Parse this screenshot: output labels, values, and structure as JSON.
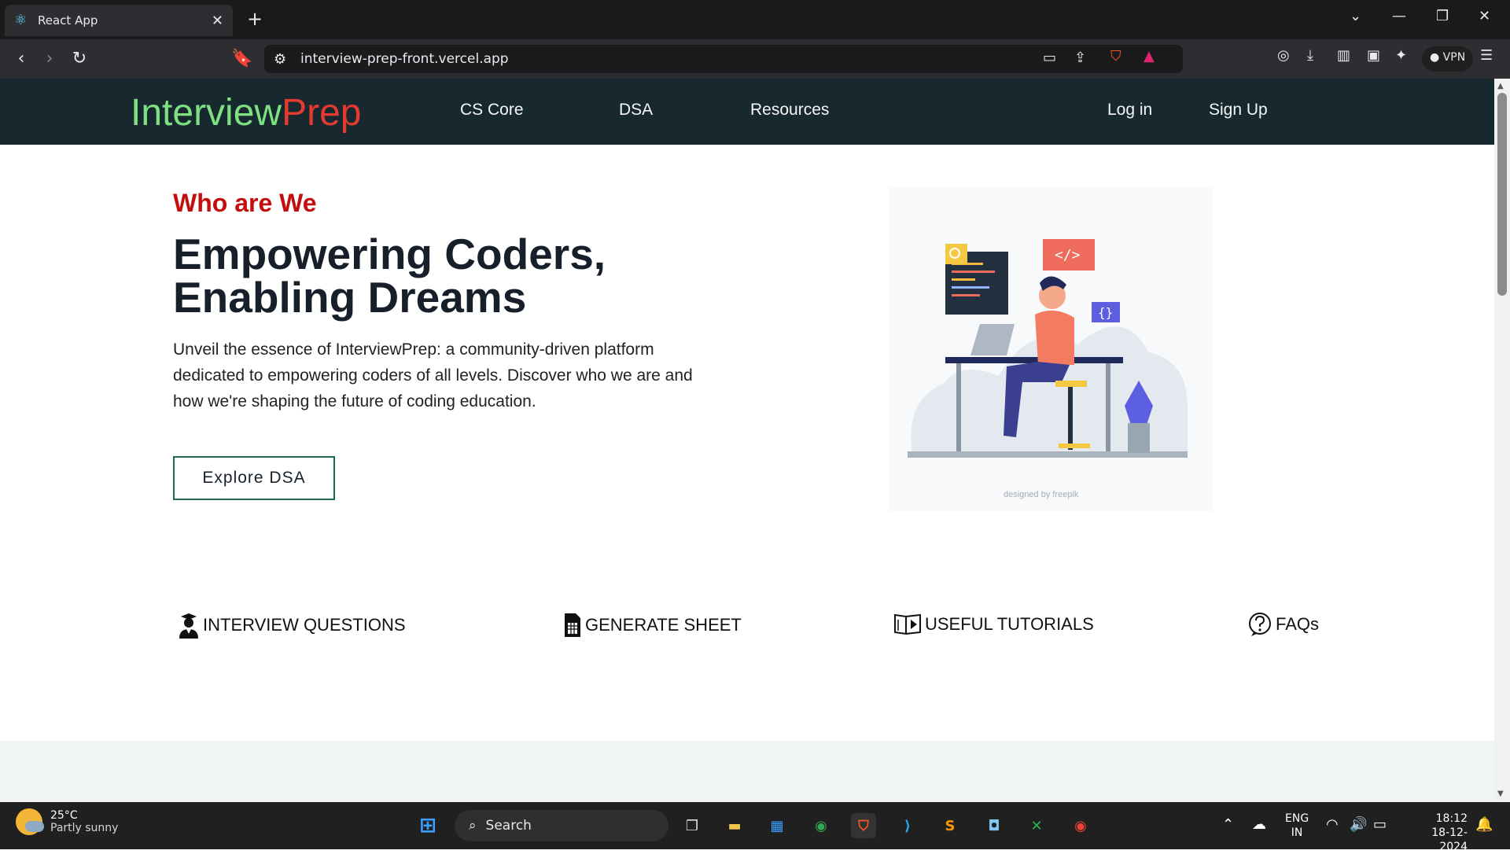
{
  "browser": {
    "tab_title": "React App",
    "url": "interview-prep-front.vercel.app",
    "vpn_label": "VPN"
  },
  "site": {
    "logo_part1": "Interview",
    "logo_part2": "Prep",
    "colors": {
      "logo_green": "#7ee081",
      "logo_red": "#e53a2f",
      "navbar_bg": "#17282f",
      "kicker_red": "#c40d0d",
      "cta_border": "#1d6b48"
    },
    "nav_links": [
      "CS Core",
      "DSA",
      "Resources"
    ],
    "auth_links": {
      "login": "Log in",
      "signup": "Sign Up"
    },
    "hero": {
      "kicker": "Who are We",
      "title": "Empowering Coders, Enabling Dreams",
      "description": "Unveil the essence of InterviewPrep: a community-driven platform dedicated to empowering coders of all levels. Discover who we are and how we're shaping the future of coding education.",
      "cta": "Explore DSA",
      "illustration_credit": "designed by  freepik"
    },
    "features": [
      {
        "icon": "student-icon",
        "label": "INTERVIEW QUESTIONS"
      },
      {
        "icon": "sheet-icon",
        "label": "GENERATE SHEET"
      },
      {
        "icon": "video-book-icon",
        "label": "USEFUL TUTORIALS"
      },
      {
        "icon": "question-circle-icon",
        "label": "FAQs"
      }
    ]
  },
  "taskbar": {
    "weather_temp": "25°C",
    "weather_desc": "Partly sunny",
    "search_label": "Search",
    "lang_top": "ENG",
    "lang_bottom": "IN",
    "time": "18:12",
    "date": "18-12-2024"
  }
}
